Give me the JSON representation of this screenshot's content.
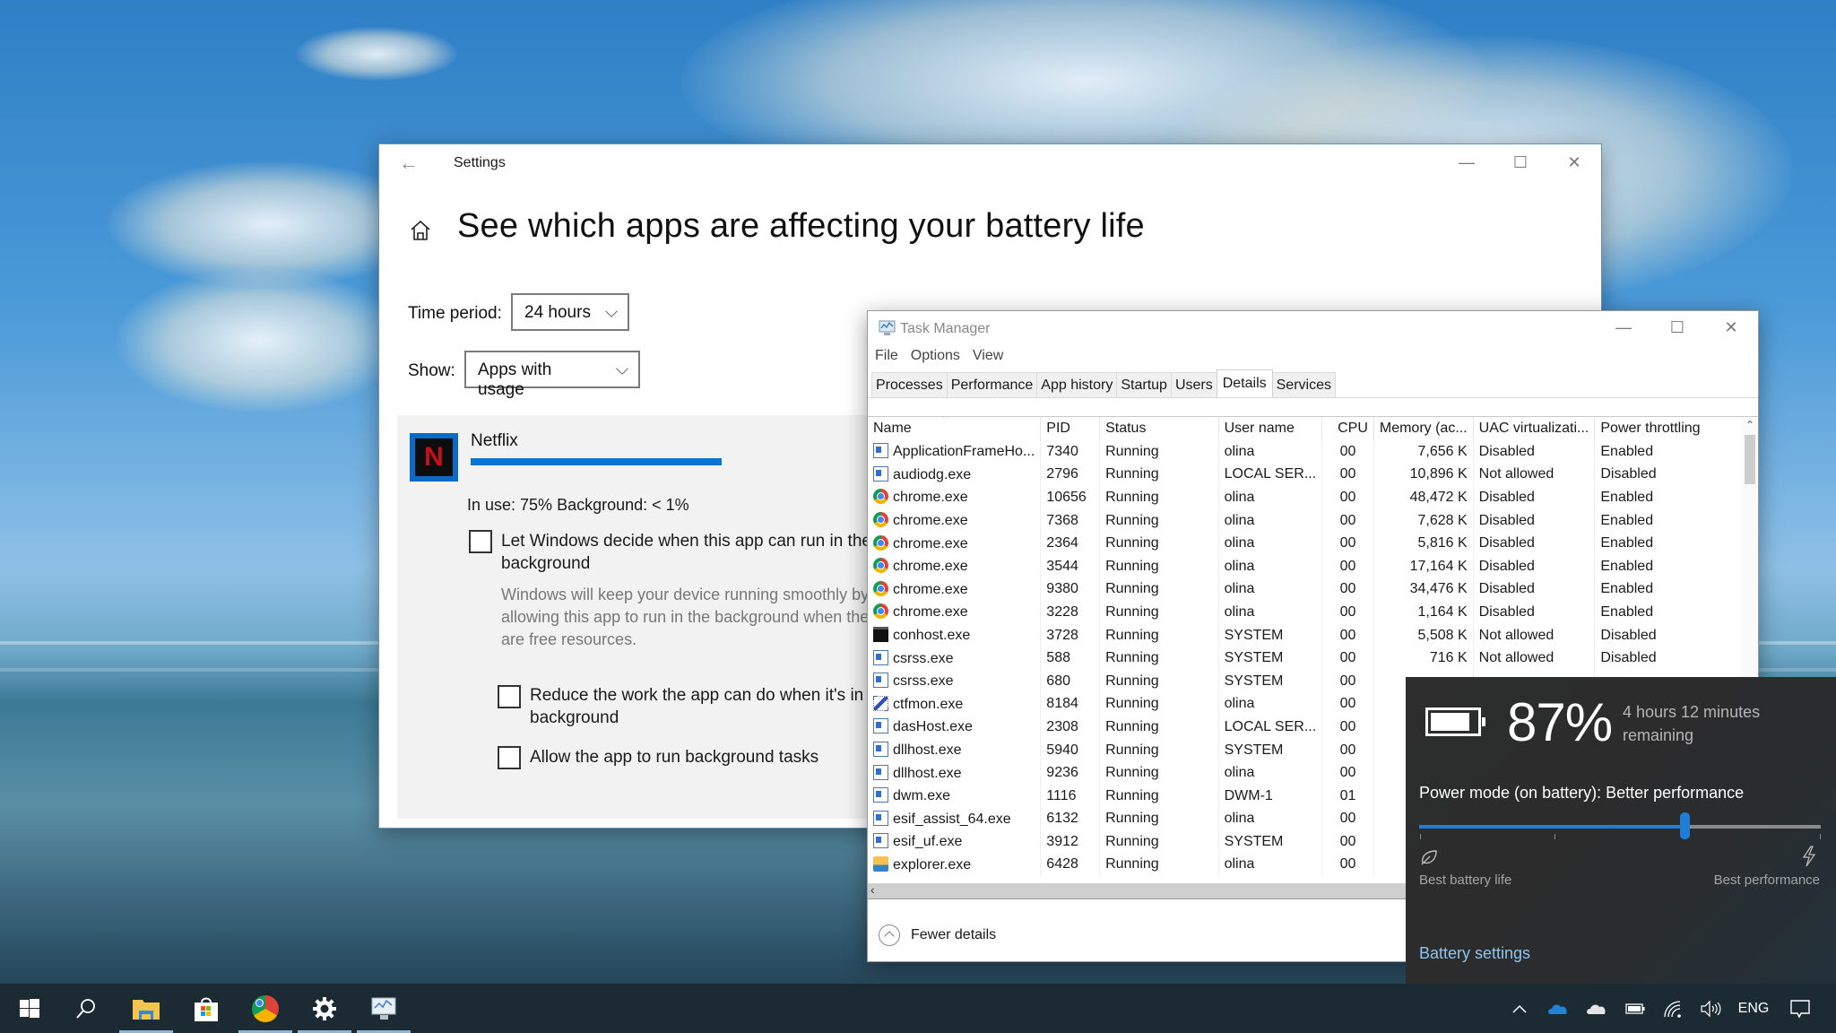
{
  "settings": {
    "title": "Settings",
    "back_icon": "back-arrow-icon",
    "window_controls": {
      "minimize": "—",
      "maximize": "☐",
      "close": "✕"
    },
    "heading": "See which apps are affecting your battery life",
    "time_period": {
      "label": "Time period:",
      "value": "24 hours"
    },
    "show": {
      "label": "Show:",
      "value": "Apps with usage"
    },
    "app": {
      "name": "Netflix",
      "icon_letter": "N",
      "usage_fraction": 0.75,
      "usage_text": "In use: 75% Background: < 1%",
      "options": [
        {
          "label_line1": "Let Windows decide when this app can run in the",
          "label_line2": "background",
          "checked": false
        },
        {
          "label_line1": "Reduce the work the app can do when it's in the",
          "label_line2": "background",
          "checked": false
        },
        {
          "label_line1": "Allow the app to run background tasks",
          "label_line2": "",
          "checked": false
        }
      ],
      "description": [
        "Windows will keep your device running smoothly by",
        "allowing this app to run in the background when there",
        "are free resources."
      ]
    }
  },
  "task_manager": {
    "title": "Task Manager",
    "window_controls": {
      "minimize": "—",
      "maximize": "☐",
      "close": "✕"
    },
    "menu": [
      "File",
      "Options",
      "View"
    ],
    "tabs": [
      "Processes",
      "Performance",
      "App history",
      "Startup",
      "Users",
      "Details",
      "Services"
    ],
    "active_tab": "Details",
    "columns": [
      "Name",
      "PID",
      "Status",
      "User name",
      "CPU",
      "Memory (ac...",
      "UAC virtualizati...",
      "Power throttling"
    ],
    "rows": [
      {
        "icon": "win",
        "name": "ApplicationFrameHo...",
        "pid": "7340",
        "status": "Running",
        "user": "olina",
        "cpu": "00",
        "mem": "7,656 K",
        "uac": "Disabled",
        "throttle": "Enabled"
      },
      {
        "icon": "win",
        "name": "audiodg.exe",
        "pid": "2796",
        "status": "Running",
        "user": "LOCAL SER...",
        "cpu": "00",
        "mem": "10,896 K",
        "uac": "Not allowed",
        "throttle": "Disabled"
      },
      {
        "icon": "chrome",
        "name": "chrome.exe",
        "pid": "10656",
        "status": "Running",
        "user": "olina",
        "cpu": "00",
        "mem": "48,472 K",
        "uac": "Disabled",
        "throttle": "Enabled"
      },
      {
        "icon": "chrome",
        "name": "chrome.exe",
        "pid": "7368",
        "status": "Running",
        "user": "olina",
        "cpu": "00",
        "mem": "7,628 K",
        "uac": "Disabled",
        "throttle": "Enabled"
      },
      {
        "icon": "chrome",
        "name": "chrome.exe",
        "pid": "2364",
        "status": "Running",
        "user": "olina",
        "cpu": "00",
        "mem": "5,816 K",
        "uac": "Disabled",
        "throttle": "Enabled"
      },
      {
        "icon": "chrome",
        "name": "chrome.exe",
        "pid": "3544",
        "status": "Running",
        "user": "olina",
        "cpu": "00",
        "mem": "17,164 K",
        "uac": "Disabled",
        "throttle": "Enabled"
      },
      {
        "icon": "chrome",
        "name": "chrome.exe",
        "pid": "9380",
        "status": "Running",
        "user": "olina",
        "cpu": "00",
        "mem": "34,476 K",
        "uac": "Disabled",
        "throttle": "Enabled"
      },
      {
        "icon": "chrome",
        "name": "chrome.exe",
        "pid": "3228",
        "status": "Running",
        "user": "olina",
        "cpu": "00",
        "mem": "1,164 K",
        "uac": "Disabled",
        "throttle": "Enabled"
      },
      {
        "icon": "console",
        "name": "conhost.exe",
        "pid": "3728",
        "status": "Running",
        "user": "SYSTEM",
        "cpu": "00",
        "mem": "5,508 K",
        "uac": "Not allowed",
        "throttle": "Disabled"
      },
      {
        "icon": "win",
        "name": "csrss.exe",
        "pid": "588",
        "status": "Running",
        "user": "SYSTEM",
        "cpu": "00",
        "mem": "716 K",
        "uac": "Not allowed",
        "throttle": "Disabled"
      },
      {
        "icon": "win",
        "name": "csrss.exe",
        "pid": "680",
        "status": "Running",
        "user": "SYSTEM",
        "cpu": "00",
        "mem": "",
        "uac": "",
        "throttle": ""
      },
      {
        "icon": "pen",
        "name": "ctfmon.exe",
        "pid": "8184",
        "status": "Running",
        "user": "olina",
        "cpu": "00",
        "mem": "",
        "uac": "",
        "throttle": ""
      },
      {
        "icon": "win",
        "name": "dasHost.exe",
        "pid": "2308",
        "status": "Running",
        "user": "LOCAL SER...",
        "cpu": "00",
        "mem": "",
        "uac": "",
        "throttle": ""
      },
      {
        "icon": "win",
        "name": "dllhost.exe",
        "pid": "5940",
        "status": "Running",
        "user": "SYSTEM",
        "cpu": "00",
        "mem": "",
        "uac": "",
        "throttle": ""
      },
      {
        "icon": "win",
        "name": "dllhost.exe",
        "pid": "9236",
        "status": "Running",
        "user": "olina",
        "cpu": "00",
        "mem": "",
        "uac": "",
        "throttle": ""
      },
      {
        "icon": "win",
        "name": "dwm.exe",
        "pid": "1116",
        "status": "Running",
        "user": "DWM-1",
        "cpu": "01",
        "mem": "",
        "uac": "",
        "throttle": ""
      },
      {
        "icon": "win",
        "name": "esif_assist_64.exe",
        "pid": "6132",
        "status": "Running",
        "user": "olina",
        "cpu": "00",
        "mem": "",
        "uac": "",
        "throttle": ""
      },
      {
        "icon": "win",
        "name": "esif_uf.exe",
        "pid": "3912",
        "status": "Running",
        "user": "SYSTEM",
        "cpu": "00",
        "mem": "",
        "uac": "",
        "throttle": ""
      },
      {
        "icon": "folder",
        "name": "explorer.exe",
        "pid": "6428",
        "status": "Running",
        "user": "olina",
        "cpu": "00",
        "mem": "",
        "uac": "",
        "throttle": ""
      }
    ],
    "fewer_details": "Fewer details"
  },
  "battery_flyout": {
    "percent": "87%",
    "percent_value": 0.87,
    "remaining": "4 hours 12 minutes remaining",
    "power_mode": "Power mode (on battery): Better performance",
    "slider_value": 0.66,
    "left_label": "Best battery life",
    "right_label": "Best performance",
    "settings_link": "Battery settings",
    "accent": "#1f7fd8"
  },
  "taskbar": {
    "pinned": [
      "start-icon",
      "search-icon",
      "file-explorer-icon",
      "microsoft-store-icon",
      "chrome-icon",
      "settings-gear-icon",
      "task-manager-icon"
    ],
    "tray": {
      "language": "ENG"
    }
  }
}
